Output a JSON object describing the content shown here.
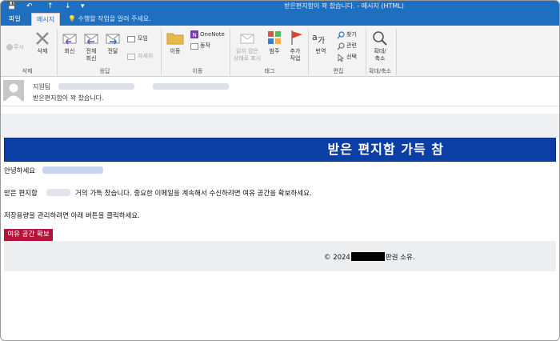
{
  "window": {
    "title": "받은편지함이 꽉 찼습니다. - 메시지 (HTML)",
    "qa_save": "💾",
    "qa_undo": "↶",
    "qa_up": "↑",
    "qa_down": "↓",
    "qa_more": "▾"
  },
  "tabs": [
    {
      "label": "파일"
    },
    {
      "label": "메시지"
    }
  ],
  "tellme": "수행할 작업을 알려 주세요.",
  "ribbon": {
    "delete": {
      "ignore": "무시",
      "delete": "삭제",
      "group": "삭제"
    },
    "respond": {
      "reply": "회신",
      "reply_all_1": "전체",
      "reply_all_2": "회신",
      "forward": "전달",
      "meeting": "모임",
      "more": "자세히",
      "group": "응답"
    },
    "move": {
      "move": "이동",
      "onenote": "OneNote",
      "actions": "동작",
      "group": "이동"
    },
    "tags": {
      "unread_1": "읽지 않은",
      "unread_2": "상태로 표시",
      "categorize": "범주",
      "followup_1": "추가",
      "followup_2": "작업",
      "group": "태그"
    },
    "editing": {
      "translate": "번역",
      "find": "찾기",
      "related": "관련",
      "select": "선택",
      "group": "편집"
    },
    "zoom": {
      "zoom_1": "확대/",
      "zoom_2": "축소",
      "group": "확대/축소"
    }
  },
  "header": {
    "sender": "지원팀",
    "subject": "받은편지함이 꽉 찼습니다."
  },
  "body": {
    "banner": "받은 편지함 가득 참",
    "greeting": "안녕하세요",
    "para1_a": "받은 편지함",
    "para1_b": "거의 가득 찼습니다. 중요한 이메일을 계속해서 수신하려면 여유 공간을 확보하세요.",
    "para2": "저장용량을 관리하려면 아래 버튼을 클릭하세요.",
    "button": "여유 공간 확보",
    "copyright_a": "© 2024",
    "copyright_b": "판권 소유."
  },
  "colors": {
    "titlebar": "#1f6fc0",
    "banner": "#0c3fa6",
    "button": "#b5123a"
  }
}
